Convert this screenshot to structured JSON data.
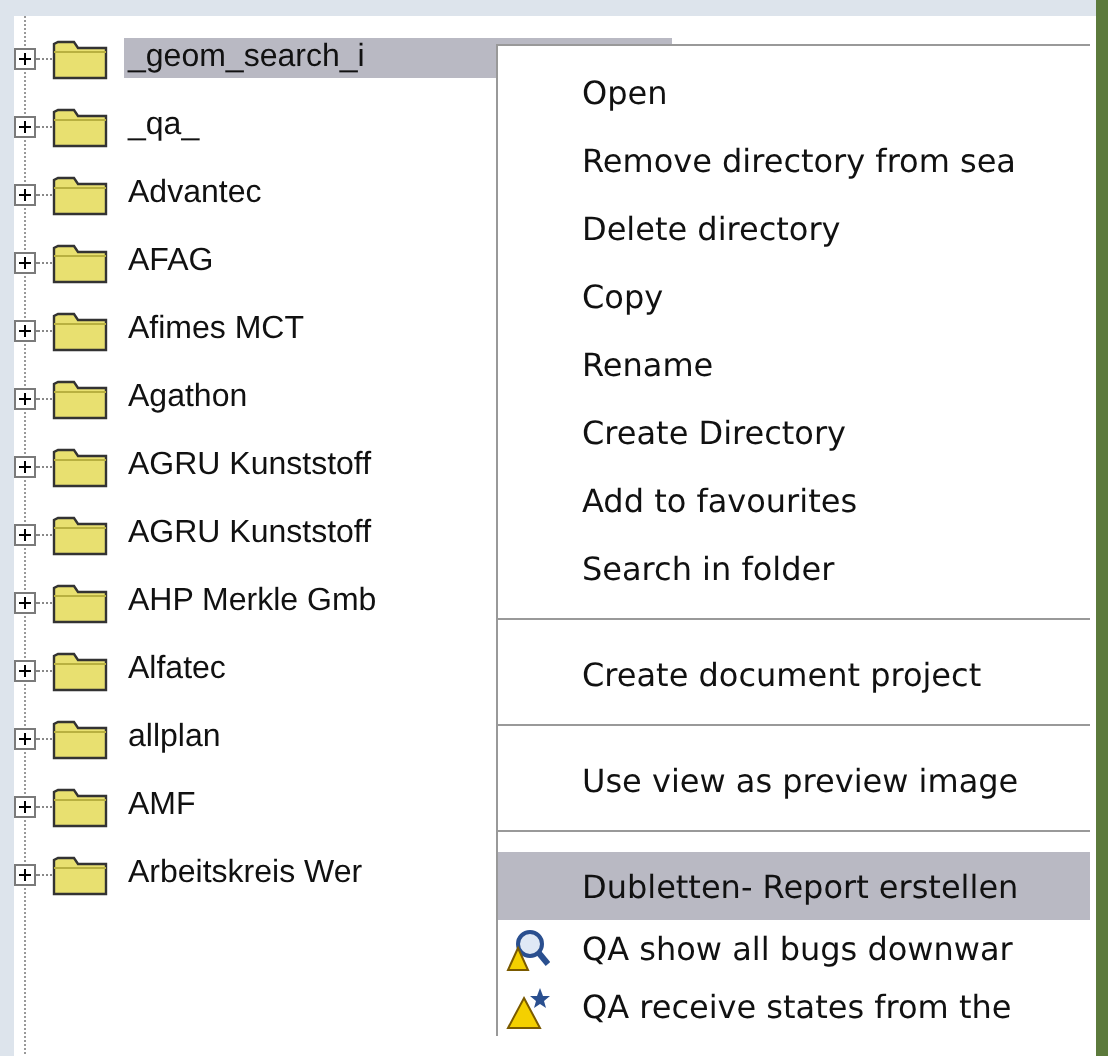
{
  "tree": {
    "items": [
      {
        "label": "_geom_search_i",
        "expanded": false,
        "selected": true
      },
      {
        "label": "_qa_",
        "expanded": false,
        "selected": false
      },
      {
        "label": "Advantec",
        "expanded": false,
        "selected": false
      },
      {
        "label": "AFAG",
        "expanded": false,
        "selected": false
      },
      {
        "label": "Afimes MCT",
        "expanded": false,
        "selected": false
      },
      {
        "label": "Agathon",
        "expanded": false,
        "selected": false
      },
      {
        "label": "AGRU Kunststoff",
        "expanded": false,
        "selected": false
      },
      {
        "label": "AGRU Kunststoff",
        "expanded": false,
        "selected": false
      },
      {
        "label": "AHP Merkle Gmb",
        "expanded": false,
        "selected": false
      },
      {
        "label": "Alfatec",
        "expanded": false,
        "selected": false
      },
      {
        "label": "allplan",
        "expanded": false,
        "selected": false
      },
      {
        "label": "AMF",
        "expanded": false,
        "selected": false
      },
      {
        "label": "Arbeitskreis Wer",
        "expanded": false,
        "selected": false
      }
    ]
  },
  "context_menu": {
    "items": [
      {
        "kind": "plain",
        "label": "Open",
        "selected": false
      },
      {
        "kind": "plain",
        "label": "Remove directory from sea",
        "selected": false
      },
      {
        "kind": "plain",
        "label": "Delete directory",
        "selected": false
      },
      {
        "kind": "plain",
        "label": "Copy",
        "selected": false
      },
      {
        "kind": "plain",
        "label": "Rename",
        "selected": false
      },
      {
        "kind": "plain",
        "label": "Create Directory",
        "selected": false
      },
      {
        "kind": "plain",
        "label": "Add to favourites",
        "selected": false
      },
      {
        "kind": "plain",
        "label": "Search in folder",
        "selected": false
      },
      {
        "kind": "separator"
      },
      {
        "kind": "plain",
        "label": "Create document project",
        "selected": false
      },
      {
        "kind": "separator"
      },
      {
        "kind": "plain",
        "label": "Use view as preview image",
        "selected": false
      },
      {
        "kind": "separator"
      },
      {
        "kind": "plain",
        "label": "Dubletten- Report erstellen",
        "selected": true
      },
      {
        "kind": "bugs",
        "label": "QA show all bugs downwar",
        "selected": false
      },
      {
        "kind": "receive",
        "label": "QA receive states from the",
        "selected": false
      }
    ]
  }
}
